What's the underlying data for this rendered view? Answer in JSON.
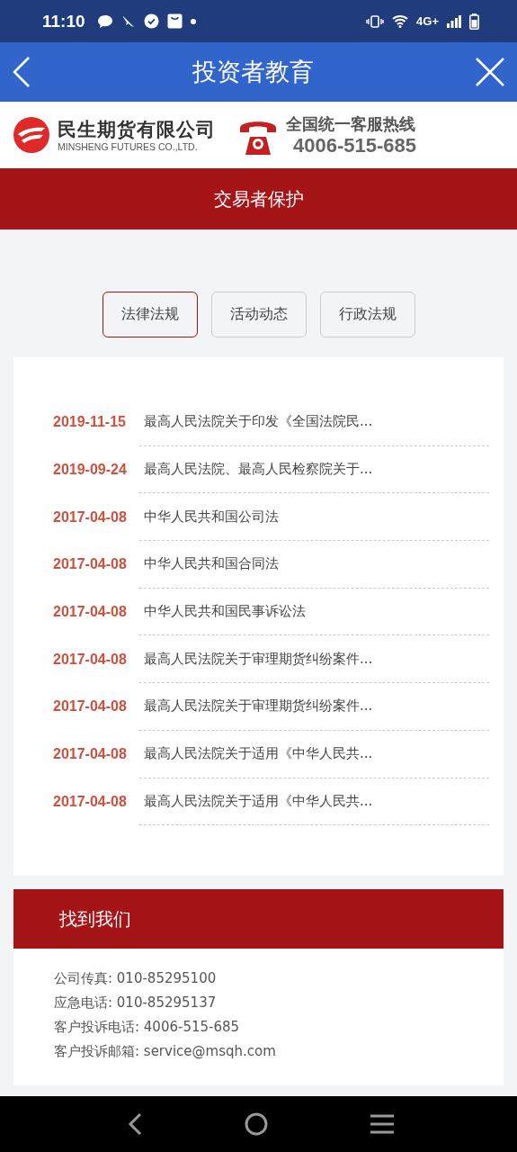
{
  "status_bar": {
    "time": "11:10",
    "network": "4G+"
  },
  "nav_bar": {
    "title": "投资者教育"
  },
  "company": {
    "name": "民生期货有限公司",
    "name_en": "MINSHENG FUTURES CO.,LTD.",
    "hotline_label": "全国统一客服热线",
    "hotline_number": "4006-515-685"
  },
  "banner": {
    "title": "交易者保护"
  },
  "tabs": [
    {
      "label": "法律法规",
      "selected": true
    },
    {
      "label": "活动动态",
      "selected": false
    },
    {
      "label": "行政法规",
      "selected": false
    }
  ],
  "articles": [
    {
      "date": "2019-11-15",
      "title": "最高人民法院关于印发《全国法院民..."
    },
    {
      "date": "2019-09-24",
      "title": "最高人民法院、最高人民检察院关于..."
    },
    {
      "date": "2017-04-08",
      "title": "中华人民共和国公司法"
    },
    {
      "date": "2017-04-08",
      "title": "中华人民共和国合同法"
    },
    {
      "date": "2017-04-08",
      "title": "中华人民共和国民事诉讼法"
    },
    {
      "date": "2017-04-08",
      "title": "最高人民法院关于审理期货纠纷案件..."
    },
    {
      "date": "2017-04-08",
      "title": "最高人民法院关于审理期货纠纷案件..."
    },
    {
      "date": "2017-04-08",
      "title": "最高人民法院关于适用《中华人民共..."
    },
    {
      "date": "2017-04-08",
      "title": "最高人民法院关于适用《中华人民共..."
    }
  ],
  "contact": {
    "title": "找到我们",
    "lines": [
      "公司传真: 010-85295100",
      "应急电话: 010-85295137",
      "客户投诉电话: 4006-515-685",
      "客户投诉邮箱: service@msqh.com"
    ]
  }
}
